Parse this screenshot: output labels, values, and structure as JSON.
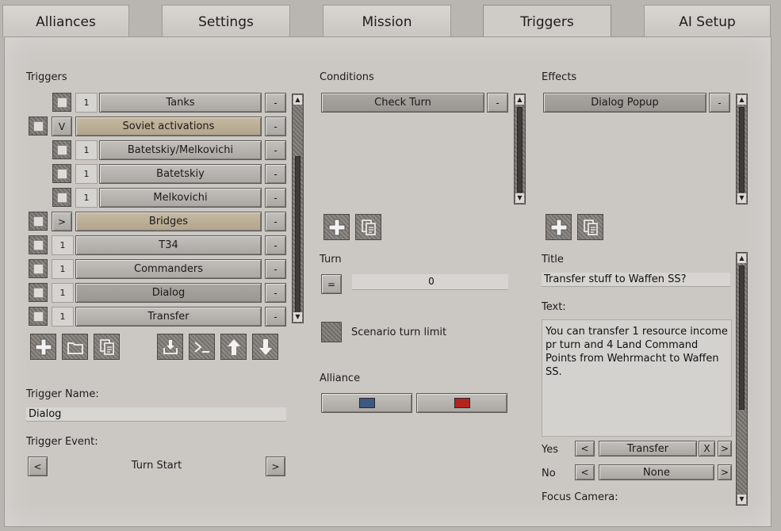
{
  "tabs": [
    {
      "label": "Alliances"
    },
    {
      "label": "Settings"
    },
    {
      "label": "Mission"
    },
    {
      "label": "Triggers"
    },
    {
      "label": "AI Setup"
    }
  ],
  "active_tab": "Triggers",
  "triggers": {
    "header": "Triggers",
    "items": [
      {
        "toggle": "1",
        "label": "Tanks",
        "indent": true,
        "style": "normal"
      },
      {
        "toggle": "V",
        "label": "Soviet activations",
        "indent": false,
        "style": "group"
      },
      {
        "toggle": "1",
        "label": "Batetskiy/Melkovichi",
        "indent": true,
        "style": "normal"
      },
      {
        "toggle": "1",
        "label": "Batetskiy",
        "indent": true,
        "style": "normal"
      },
      {
        "toggle": "1",
        "label": "Melkovichi",
        "indent": true,
        "style": "normal"
      },
      {
        "toggle": ">",
        "label": "Bridges",
        "indent": false,
        "style": "group"
      },
      {
        "toggle": "1",
        "label": "T34",
        "indent": false,
        "style": "normal"
      },
      {
        "toggle": "1",
        "label": "Commanders",
        "indent": false,
        "style": "normal"
      },
      {
        "toggle": "1",
        "label": "Dialog",
        "indent": false,
        "style": "selected"
      },
      {
        "toggle": "1",
        "label": "Transfer",
        "indent": false,
        "style": "normal"
      }
    ],
    "remove_label": "-",
    "name_label": "Trigger Name:",
    "name_value": "Dialog",
    "event_label": "Trigger Event:",
    "event_value": "Turn Start",
    "prev": "<",
    "next": ">"
  },
  "conditions": {
    "header": "Conditions",
    "items": [
      {
        "label": "Check Turn"
      }
    ],
    "remove_label": "-",
    "turn_label": "Turn",
    "turn_op": "=",
    "turn_value": "0",
    "scenario_limit_label": "Scenario turn limit",
    "alliance_label": "Alliance",
    "alliance_colors": [
      "#3c5a80",
      "#b3241e"
    ]
  },
  "effects": {
    "header": "Effects",
    "items": [
      {
        "label": "Dialog Popup"
      }
    ],
    "remove_label": "-",
    "title_label": "Title",
    "title_value": "Transfer stuff to Waffen SS?",
    "text_label": "Text:",
    "text_value": "You can transfer 1 resource income pr turn and 4 Land Command Points from Wehrmacht to Waffen SS.",
    "yes_label": "Yes",
    "yes_value": "Transfer",
    "no_label": "No",
    "no_value": "None",
    "clear_label": "X",
    "prev": "<",
    "next": ">",
    "focus_label": "Focus Camera:"
  },
  "icons": [
    "plus-icon",
    "folder-icon",
    "copy-icon",
    "import-icon",
    "terminal-icon",
    "arrow-up-icon",
    "arrow-down-icon",
    "scroll-up-icon",
    "scroll-down-icon"
  ]
}
